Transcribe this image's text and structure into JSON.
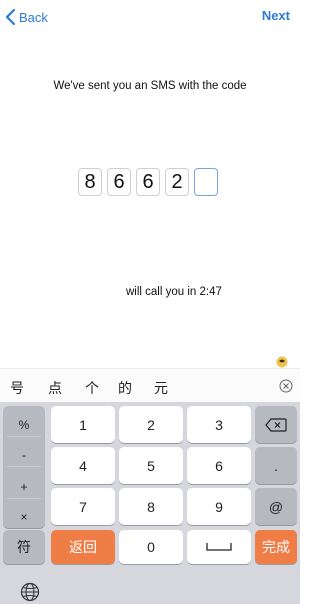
{
  "nav": {
    "back_label": "Back",
    "next_label": "Next",
    "accent_color": "#2f7ad6"
  },
  "verification": {
    "message": "We've sent you an SMS with the code",
    "code_digits": [
      "8",
      "6",
      "6",
      "2",
      ""
    ],
    "call_message": "will call you in 2:47"
  },
  "candidates": [
    "号",
    "点",
    "个",
    "的",
    "元"
  ],
  "keyboard": {
    "side_symbols": [
      "%",
      "-",
      "+",
      "×"
    ],
    "rows": [
      [
        "1",
        "2",
        "3"
      ],
      [
        "4",
        "5",
        "6"
      ],
      [
        "7",
        "8",
        "9"
      ]
    ],
    "right_keys": [
      "",
      ".",
      "@"
    ],
    "symbols_label": "符",
    "return_label": "返回",
    "zero_label": "0",
    "done_label": "完成",
    "icons": [
      "chevron-left-icon",
      "backspace-icon",
      "close-circle-icon",
      "globe-icon",
      "space-icon"
    ],
    "colors": {
      "orange": "#ef7d46",
      "key_gray": "#b6b9c0",
      "background": "#d6d7dc"
    }
  }
}
